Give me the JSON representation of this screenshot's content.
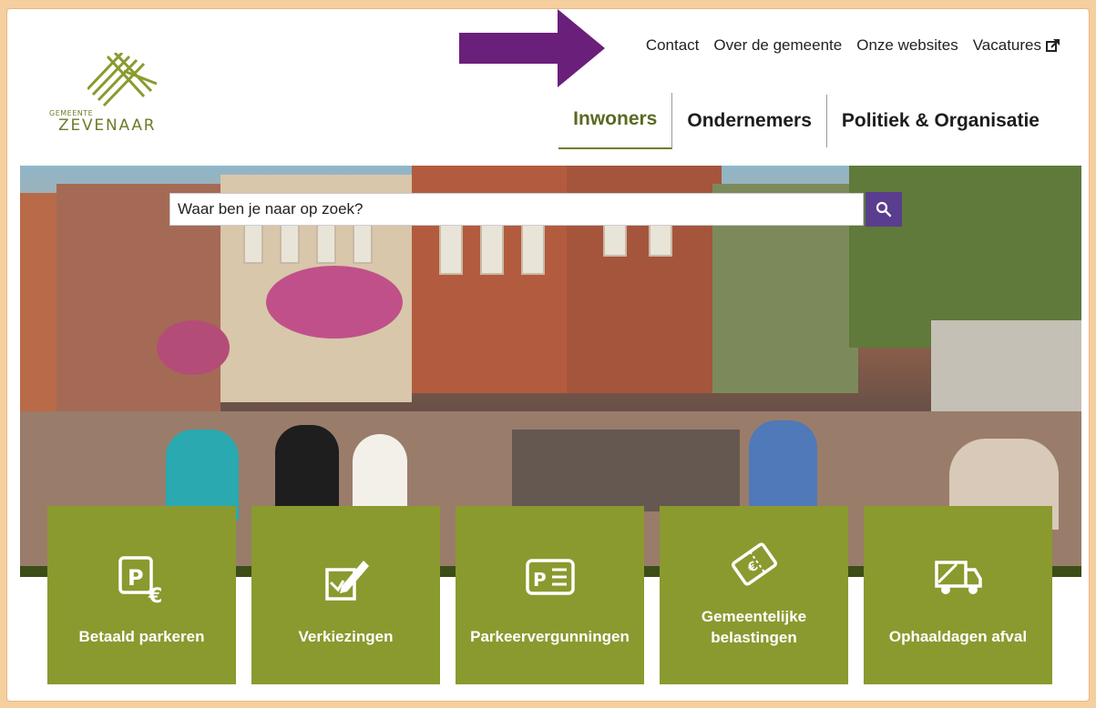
{
  "header": {
    "logo_small": "GEMEENTE",
    "logo_big": "ZEVENAAR",
    "topnav": [
      "Contact",
      "Over de gemeente",
      "Onze websites",
      "Vacatures"
    ],
    "mainnav": [
      "Inwoners",
      "Ondernemers",
      "Politiek & Organisatie"
    ]
  },
  "search": {
    "placeholder": "Waar ben je naar op zoek?"
  },
  "tiles": [
    {
      "label": "Betaald parkeren",
      "icon": "parking-euro-icon"
    },
    {
      "label": "Verkiezingen",
      "icon": "ballot-icon"
    },
    {
      "label": "Parkeervergunningen",
      "icon": "parking-permit-icon"
    },
    {
      "label": "Gemeentelijke belastingen",
      "icon": "tax-ticket-icon"
    },
    {
      "label": "Ophaaldagen afval",
      "icon": "garbage-truck-icon"
    }
  ],
  "colors": {
    "brand_green": "#8a9a2f",
    "accent_purple": "#5a3d8e",
    "frame": "#f6cf9f",
    "annotation_arrow": "#6a1f7a"
  }
}
